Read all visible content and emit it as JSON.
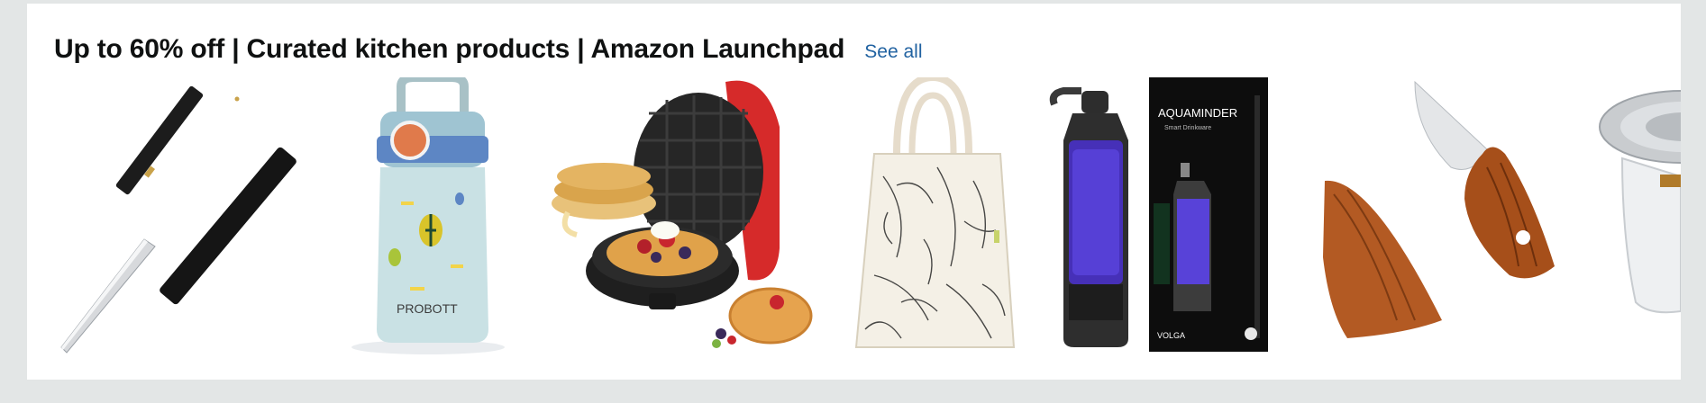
{
  "header": {
    "title": "Up to 60% off | Curated kitchen products | Amazon Launchpad",
    "see_all_label": "See all"
  },
  "products": [
    {
      "name": "knife-with-sheath",
      "icon": "kitchen-knife-icon"
    },
    {
      "name": "probott-kids-bottle",
      "icon": "water-bottle-icon",
      "brand_text": "PROBOTT"
    },
    {
      "name": "mini-waffle-maker",
      "icon": "waffle-maker-icon"
    },
    {
      "name": "printed-tote-bag",
      "icon": "tote-bag-icon"
    },
    {
      "name": "aquaminder-smart-bottle",
      "icon": "smart-bottle-icon",
      "brand_text": "AQUAMINDER",
      "tagline": "Smart Drinkware",
      "model_text": "VOLGA"
    },
    {
      "name": "wooden-knife-sheath",
      "icon": "wood-sheath-icon"
    },
    {
      "name": "glass-pour-over-dripper",
      "icon": "dripper-icon"
    }
  ],
  "colors": {
    "page_bg": "#e3e6e6",
    "card_bg": "#ffffff",
    "title": "#0f1111",
    "link": "#2162a1"
  }
}
